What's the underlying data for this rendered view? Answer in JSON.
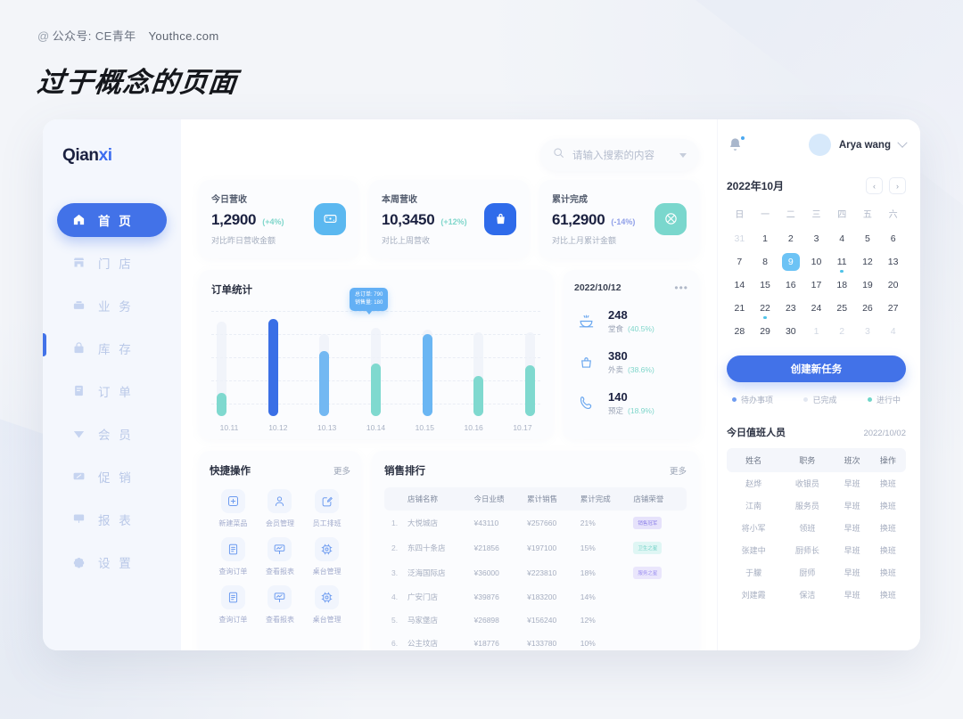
{
  "header": {
    "kicker_at": "@",
    "kicker_label": "公众号: CE青年",
    "kicker_site": "Youthce.com",
    "title": "过于概念的页面"
  },
  "sidebar": {
    "logo_main": "Qian",
    "logo_accent": "xi",
    "items": [
      {
        "label": "首 页",
        "icon": "home-icon",
        "active": true
      },
      {
        "label": "门 店",
        "icon": "store-icon",
        "active": false
      },
      {
        "label": "业 务",
        "icon": "business-icon",
        "active": false
      },
      {
        "label": "库 存",
        "icon": "inventory-icon",
        "active": false
      },
      {
        "label": "订 单",
        "icon": "order-icon",
        "active": false
      },
      {
        "label": "会 员",
        "icon": "member-icon",
        "active": false
      },
      {
        "label": "促 销",
        "icon": "promotion-icon",
        "active": false
      },
      {
        "label": "报 表",
        "icon": "report-icon",
        "active": false
      },
      {
        "label": "设 置",
        "icon": "settings-icon",
        "active": false
      }
    ]
  },
  "search": {
    "placeholder": "请输入搜索的内容",
    "icon": "search-icon"
  },
  "stats": [
    {
      "label": "今日营收",
      "value": "1,2900",
      "delta": "(+4%)",
      "delta_color": "#7fd6cb",
      "sub": "对比昨日营收金额",
      "icon": "wallet-icon",
      "icon_bg": "#5bb8f0"
    },
    {
      "label": "本周营收",
      "value": "10,3450",
      "delta": "(+12%)",
      "delta_color": "#7fd6cb",
      "sub": "对比上周营收",
      "icon": "bag-icon",
      "icon_bg": "#2f6bea"
    },
    {
      "label": "累计完成",
      "value": "61,2900",
      "delta": "(-14%)",
      "delta_color": "#8f9fe8",
      "sub": "对比上月累计金额",
      "icon": "target-icon",
      "icon_bg": "#7ad7cd"
    }
  ],
  "chart_card": {
    "title": "订单统计"
  },
  "chart_data": {
    "type": "bar",
    "title": "订单统计",
    "categories": [
      "10.11",
      "10.12",
      "10.13",
      "10.14",
      "10.15",
      "10.16",
      "10.17"
    ],
    "values": [
      22,
      92,
      62,
      50,
      78,
      38,
      48
    ],
    "track_heights": [
      90,
      92,
      78,
      84,
      82,
      80,
      80
    ],
    "colors": [
      "#7fd9cf",
      "#3a6fe6",
      "#73b8f2",
      "#7fd9cf",
      "#6ab6f3",
      "#7fd9cf",
      "#7fd9cf"
    ],
    "xlabel": "",
    "ylabel": "",
    "ylim": [
      0,
      100
    ],
    "grid": true,
    "tooltip": {
      "index": 3,
      "line1": "总订单: 790",
      "line2": "销售量: 180"
    }
  },
  "orders_card": {
    "date": "2022/10/12",
    "menu_icon": "ellipsis-icon",
    "rows": [
      {
        "num": "248",
        "label": "堂食",
        "pct": "(40.5%)",
        "icon": "dine-in-icon"
      },
      {
        "num": "380",
        "label": "外卖",
        "pct": "(38.6%)",
        "icon": "takeout-icon"
      },
      {
        "num": "140",
        "label": "预定",
        "pct": "(18.9%)",
        "icon": "phone-icon"
      }
    ]
  },
  "quick_actions": {
    "title": "快捷操作",
    "more": "更多",
    "items": [
      {
        "label": "新建菜品",
        "icon": "plus-square-icon"
      },
      {
        "label": "会员管理",
        "icon": "user-icon"
      },
      {
        "label": "员工排班",
        "icon": "edit-square-icon"
      },
      {
        "label": "查询订单",
        "icon": "document-icon"
      },
      {
        "label": "查看报表",
        "icon": "chart-board-icon"
      },
      {
        "label": "桌台管理",
        "icon": "table-chip-icon"
      },
      {
        "label": "查询订单",
        "icon": "document-icon"
      },
      {
        "label": "查看报表",
        "icon": "chart-board-icon"
      },
      {
        "label": "桌台管理",
        "icon": "table-chip-icon"
      }
    ]
  },
  "sales_rank": {
    "title": "销售排行",
    "more": "更多",
    "columns": [
      "",
      "店铺名称",
      "今日业绩",
      "累计销售",
      "累计完成",
      "店铺荣誉"
    ],
    "rows": [
      {
        "idx": "1.",
        "shop": "大悦城店",
        "today": "¥43110",
        "total": "¥257660",
        "pct": "21%",
        "badge": "销售冠军",
        "badge_bg": "#e6e2fb",
        "badge_color": "#8b7fe8"
      },
      {
        "idx": "2.",
        "shop": "东四十条店",
        "today": "¥21856",
        "total": "¥197100",
        "pct": "15%",
        "badge": "卫生之星",
        "badge_bg": "#dff6f4",
        "badge_color": "#6fd0c6"
      },
      {
        "idx": "3.",
        "shop": "泛海国际店",
        "today": "¥36000",
        "total": "¥223810",
        "pct": "18%",
        "badge": "服务之星",
        "badge_bg": "#eae6fc",
        "badge_color": "#9b8ef0"
      },
      {
        "idx": "4.",
        "shop": "广安门店",
        "today": "¥39876",
        "total": "¥183200",
        "pct": "14%",
        "badge": "",
        "badge_bg": "",
        "badge_color": ""
      },
      {
        "idx": "5.",
        "shop": "马家堡店",
        "today": "¥26898",
        "total": "¥156240",
        "pct": "12%",
        "badge": "",
        "badge_bg": "",
        "badge_color": ""
      },
      {
        "idx": "6.",
        "shop": "公主坟店",
        "today": "¥18776",
        "total": "¥133780",
        "pct": "10%",
        "badge": "",
        "badge_bg": "",
        "badge_color": ""
      }
    ]
  },
  "right": {
    "user_name": "Arya wang",
    "bell_icon": "bell-icon",
    "calendar": {
      "month_label": "2022年10月",
      "prev": "‹",
      "next": "›",
      "dow": [
        "日",
        "一",
        "二",
        "三",
        "四",
        "五",
        "六"
      ],
      "weeks": [
        [
          {
            "d": "31",
            "mute": true
          },
          {
            "d": "1"
          },
          {
            "d": "2"
          },
          {
            "d": "3"
          },
          {
            "d": "4"
          },
          {
            "d": "5"
          },
          {
            "d": "6"
          }
        ],
        [
          {
            "d": "7"
          },
          {
            "d": "8"
          },
          {
            "d": "9",
            "sel": true
          },
          {
            "d": "10"
          },
          {
            "d": "11",
            "dot": true
          },
          {
            "d": "12"
          },
          {
            "d": "13"
          }
        ],
        [
          {
            "d": "14"
          },
          {
            "d": "15"
          },
          {
            "d": "16"
          },
          {
            "d": "17"
          },
          {
            "d": "18"
          },
          {
            "d": "19"
          },
          {
            "d": "20"
          }
        ],
        [
          {
            "d": "21"
          },
          {
            "d": "22",
            "dot": true
          },
          {
            "d": "23"
          },
          {
            "d": "24"
          },
          {
            "d": "25"
          },
          {
            "d": "26"
          },
          {
            "d": "27"
          }
        ],
        [
          {
            "d": "28"
          },
          {
            "d": "29"
          },
          {
            "d": "30"
          },
          {
            "d": "1",
            "mute": true
          },
          {
            "d": "2",
            "mute": true
          },
          {
            "d": "3",
            "mute": true
          },
          {
            "d": "4",
            "mute": true
          }
        ]
      ]
    },
    "task_button": "创建新任务",
    "legend": [
      {
        "label": "待办事项",
        "color": "#6e9bf0"
      },
      {
        "label": "已完成",
        "color": "#e2e7f1"
      },
      {
        "label": "进行中",
        "color": "#6fd6c9"
      }
    ],
    "duty": {
      "title": "今日值班人员",
      "date": "2022/10/02",
      "columns": [
        "姓名",
        "职务",
        "班次",
        "操作"
      ],
      "rows": [
        {
          "name": "赵烨",
          "role": "收银员",
          "shift": "早班",
          "action": "换班"
        },
        {
          "name": "江南",
          "role": "服务员",
          "shift": "早班",
          "action": "换班"
        },
        {
          "name": "将小军",
          "role": "领班",
          "shift": "早班",
          "action": "换班"
        },
        {
          "name": "张建中",
          "role": "厨师长",
          "shift": "早班",
          "action": "换班"
        },
        {
          "name": "于朦",
          "role": "厨师",
          "shift": "早班",
          "action": "换班"
        },
        {
          "name": "刘建霞",
          "role": "保洁",
          "shift": "早班",
          "action": "换班"
        }
      ]
    }
  }
}
